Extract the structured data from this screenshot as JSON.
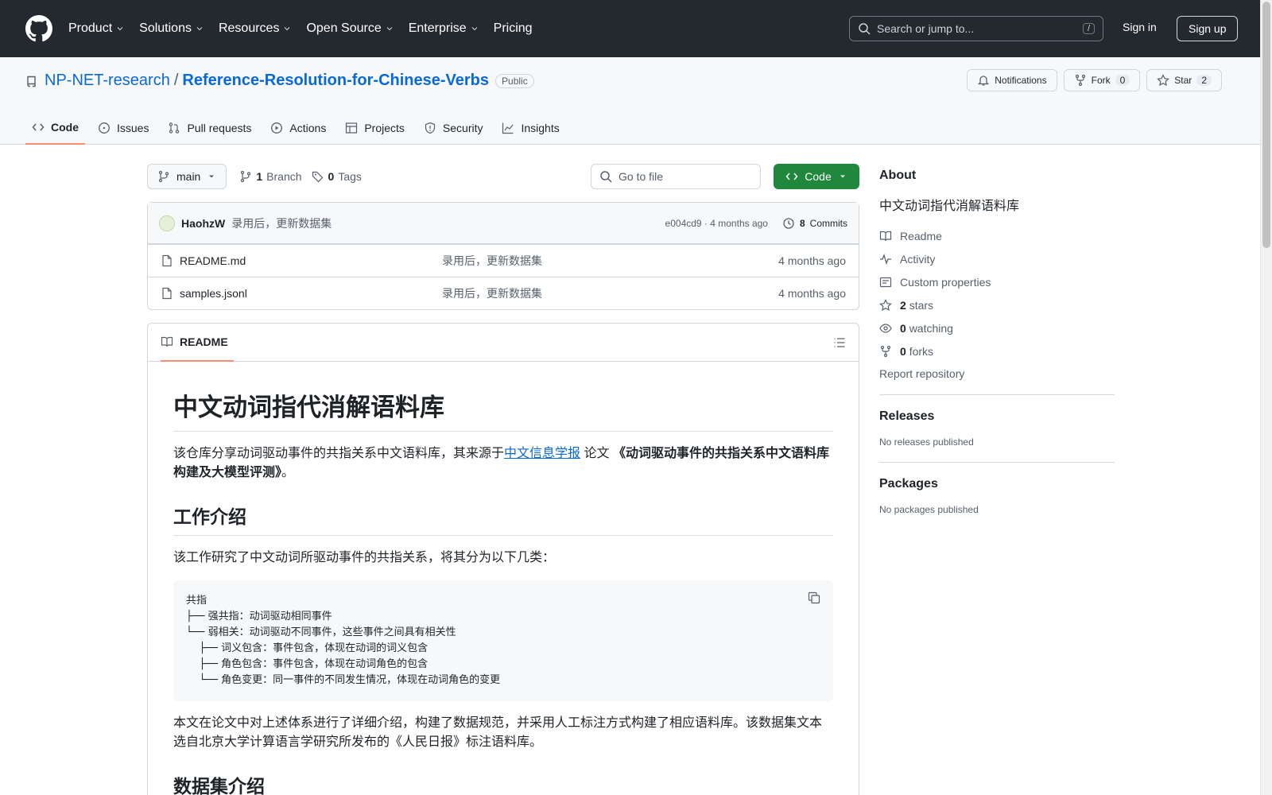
{
  "header": {
    "nav": [
      {
        "label": "Product",
        "has_menu": true
      },
      {
        "label": "Solutions",
        "has_menu": true
      },
      {
        "label": "Resources",
        "has_menu": true
      },
      {
        "label": "Open Source",
        "has_menu": true
      },
      {
        "label": "Enterprise",
        "has_menu": true
      },
      {
        "label": "Pricing",
        "has_menu": false
      }
    ],
    "search_placeholder": "Search or jump to...",
    "search_shortcut": "/",
    "sign_in": "Sign in",
    "sign_up": "Sign up"
  },
  "repo": {
    "owner": "NP-NET-research",
    "separator": "/",
    "name": "Reference-Resolution-for-Chinese-Verbs",
    "visibility": "Public",
    "notifications_label": "Notifications",
    "fork_label": "Fork",
    "fork_count": "0",
    "star_label": "Star",
    "star_count": "2"
  },
  "tabs": [
    {
      "label": "Code",
      "icon": "code-icon",
      "active": true
    },
    {
      "label": "Issues",
      "icon": "issue-icon",
      "active": false
    },
    {
      "label": "Pull requests",
      "icon": "pull-request-icon",
      "active": false
    },
    {
      "label": "Actions",
      "icon": "play-icon",
      "active": false
    },
    {
      "label": "Projects",
      "icon": "table-icon",
      "active": false
    },
    {
      "label": "Security",
      "icon": "shield-icon",
      "active": false
    },
    {
      "label": "Insights",
      "icon": "graph-icon",
      "active": false
    }
  ],
  "toolbar": {
    "branch": "main",
    "branch_count": "1",
    "branch_label": "Branch",
    "tag_count": "0",
    "tag_label": "Tags",
    "go_to_file": "Go to file",
    "code_button": "Code"
  },
  "commit": {
    "author": "HaohzW",
    "message": "录用后，更新数据集",
    "hash_time": "e004cd9 · 4 months ago",
    "commits_count": "8",
    "commits_label": "Commits"
  },
  "files": [
    {
      "name": "README.md",
      "message": "录用后，更新数据集",
      "time": "4 months ago"
    },
    {
      "name": "samples.jsonl",
      "message": "录用后，更新数据集",
      "time": "4 months ago"
    }
  ],
  "readme": {
    "tab_label": "README",
    "title": "中文动词指代消解语料库",
    "intro_before_link": "该仓库分享动词驱动事件的共指关系中文语料库，其来源于",
    "intro_link": "中文信息学报",
    "intro_after_link": " 论文 ",
    "intro_bold": "《动词驱动事件的共指关系中文语料库构建及大模型评测》",
    "intro_end": "。",
    "h2_work": "工作介绍",
    "work_para": "该工作研究了中文动词所驱动事件的共指关系，将其分为以下几类：",
    "code_block": "共指\n├── 强共指：动词驱动相同事件\n└── 弱相关：动词驱动不同事件，这些事件之间具有相关性\n    ├── 词义包含：事件包含，体现在动词的词义包含\n    ├── 角色包含：事件包含，体现在动词角色的包含\n    └── 角色变更：同一事件的不同发生情况，体现在动词角色的变更",
    "para2": "本文在论文中对上述体系进行了详细介绍，构建了数据规范，并采用人工标注方式构建了相应语料库。该数据集文本选自北京大学计算语言学研究所发布的《人民日报》标注语料库。",
    "h2_dataset": "数据集介绍"
  },
  "about": {
    "heading": "About",
    "description": "中文动词指代消解语料库",
    "readme": "Readme",
    "activity": "Activity",
    "custom_properties": "Custom properties",
    "stars_count": "2",
    "stars_label": "stars",
    "watching_count": "0",
    "watching_label": "watching",
    "forks_count": "0",
    "forks_label": "forks",
    "report": "Report repository"
  },
  "releases": {
    "heading": "Releases",
    "empty": "No releases published"
  },
  "packages": {
    "heading": "Packages",
    "empty": "No packages published"
  },
  "colors": {
    "header_bg": "#24292f",
    "accent": "#0969da",
    "green": "#1f883d",
    "tab_underline": "#fd8c73"
  }
}
